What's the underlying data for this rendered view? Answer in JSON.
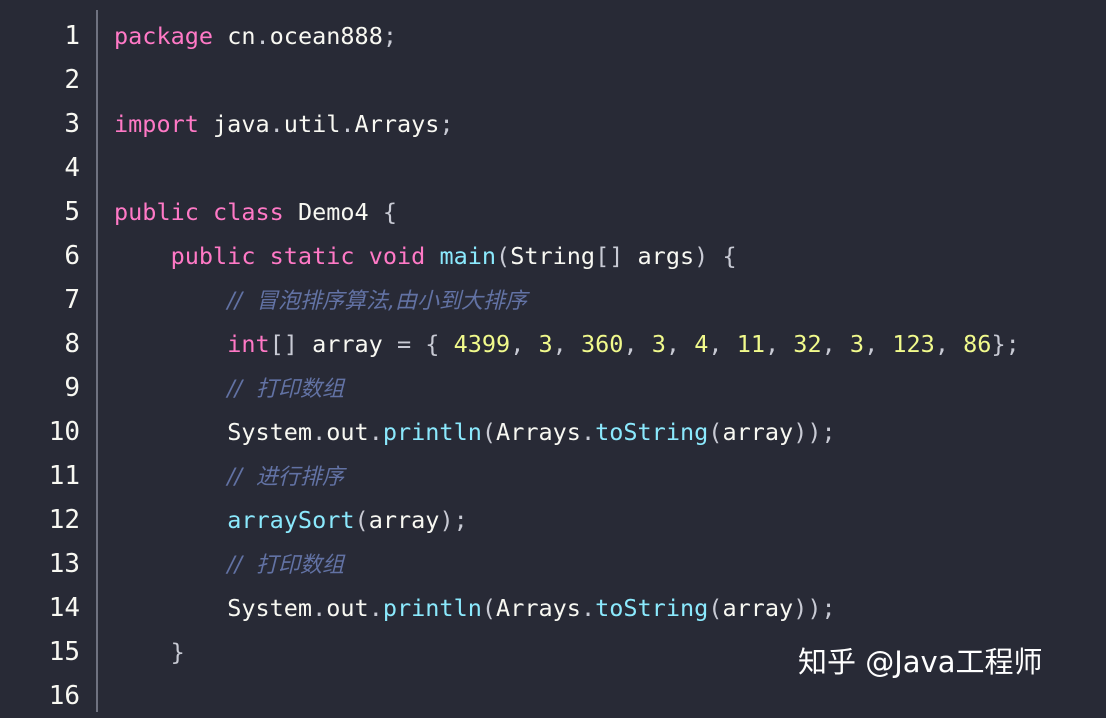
{
  "theme": {
    "background": "#282a36",
    "keyword_color": "#ff79c6",
    "function_color": "#8be9fd",
    "number_color": "#f1fa8c",
    "comment_color": "#6272a4",
    "text_color": "#f8f8f2"
  },
  "gutter": {
    "line_numbers": [
      "1",
      "2",
      "3",
      "4",
      "5",
      "6",
      "7",
      "8",
      "9",
      "10",
      "11",
      "12",
      "13",
      "14",
      "15",
      "16"
    ]
  },
  "code": {
    "lines": [
      [
        {
          "t": "package",
          "c": "kw"
        },
        {
          "t": " cn"
        },
        {
          "t": ".",
          "c": "pn"
        },
        {
          "t": "ocean888"
        },
        {
          "t": ";",
          "c": "pn"
        }
      ],
      [],
      [
        {
          "t": "import",
          "c": "kw"
        },
        {
          "t": " java"
        },
        {
          "t": ".",
          "c": "pn"
        },
        {
          "t": "util"
        },
        {
          "t": ".",
          "c": "pn"
        },
        {
          "t": "Arrays"
        },
        {
          "t": ";",
          "c": "pn"
        }
      ],
      [],
      [
        {
          "t": "public",
          "c": "kw"
        },
        {
          "t": " "
        },
        {
          "t": "class",
          "c": "kw"
        },
        {
          "t": " Demo4 "
        },
        {
          "t": "{",
          "c": "pn"
        }
      ],
      [
        {
          "t": "    "
        },
        {
          "t": "public",
          "c": "kw"
        },
        {
          "t": " "
        },
        {
          "t": "static",
          "c": "kw"
        },
        {
          "t": " "
        },
        {
          "t": "void",
          "c": "kw"
        },
        {
          "t": " "
        },
        {
          "t": "main",
          "c": "fn"
        },
        {
          "t": "(",
          "c": "pn"
        },
        {
          "t": "String"
        },
        {
          "t": "[]",
          "c": "pn"
        },
        {
          "t": " args"
        },
        {
          "t": ")",
          "c": "pn"
        },
        {
          "t": " "
        },
        {
          "t": "{",
          "c": "pn"
        }
      ],
      [
        {
          "t": "        "
        },
        {
          "t": "//  冒泡排序算法,由小到大排序",
          "c": "cm"
        }
      ],
      [
        {
          "t": "        "
        },
        {
          "t": "int",
          "c": "kw"
        },
        {
          "t": "[]",
          "c": "pn"
        },
        {
          "t": " array "
        },
        {
          "t": "=",
          "c": "pn"
        },
        {
          "t": " "
        },
        {
          "t": "{",
          "c": "pn"
        },
        {
          "t": " "
        },
        {
          "t": "4399",
          "c": "num"
        },
        {
          "t": ",",
          "c": "pn"
        },
        {
          "t": " "
        },
        {
          "t": "3",
          "c": "num"
        },
        {
          "t": ",",
          "c": "pn"
        },
        {
          "t": " "
        },
        {
          "t": "360",
          "c": "num"
        },
        {
          "t": ",",
          "c": "pn"
        },
        {
          "t": " "
        },
        {
          "t": "3",
          "c": "num"
        },
        {
          "t": ",",
          "c": "pn"
        },
        {
          "t": " "
        },
        {
          "t": "4",
          "c": "num"
        },
        {
          "t": ",",
          "c": "pn"
        },
        {
          "t": " "
        },
        {
          "t": "11",
          "c": "num"
        },
        {
          "t": ",",
          "c": "pn"
        },
        {
          "t": " "
        },
        {
          "t": "32",
          "c": "num"
        },
        {
          "t": ",",
          "c": "pn"
        },
        {
          "t": " "
        },
        {
          "t": "3",
          "c": "num"
        },
        {
          "t": ",",
          "c": "pn"
        },
        {
          "t": " "
        },
        {
          "t": "123",
          "c": "num"
        },
        {
          "t": ",",
          "c": "pn"
        },
        {
          "t": " "
        },
        {
          "t": "86",
          "c": "num"
        },
        {
          "t": "};",
          "c": "pn"
        }
      ],
      [
        {
          "t": "        "
        },
        {
          "t": "//  打印数组",
          "c": "cm"
        }
      ],
      [
        {
          "t": "        "
        },
        {
          "t": "System"
        },
        {
          "t": ".",
          "c": "pn"
        },
        {
          "t": "out"
        },
        {
          "t": ".",
          "c": "pn"
        },
        {
          "t": "println",
          "c": "fn"
        },
        {
          "t": "(",
          "c": "pn"
        },
        {
          "t": "Arrays"
        },
        {
          "t": ".",
          "c": "pn"
        },
        {
          "t": "toString",
          "c": "fn"
        },
        {
          "t": "(",
          "c": "pn"
        },
        {
          "t": "array"
        },
        {
          "t": "));",
          "c": "pn"
        }
      ],
      [
        {
          "t": "        "
        },
        {
          "t": "//  进行排序",
          "c": "cm"
        }
      ],
      [
        {
          "t": "        "
        },
        {
          "t": "arraySort",
          "c": "fn"
        },
        {
          "t": "(",
          "c": "pn"
        },
        {
          "t": "array"
        },
        {
          "t": ");",
          "c": "pn"
        }
      ],
      [
        {
          "t": "        "
        },
        {
          "t": "//  打印数组",
          "c": "cm"
        }
      ],
      [
        {
          "t": "        "
        },
        {
          "t": "System"
        },
        {
          "t": ".",
          "c": "pn"
        },
        {
          "t": "out"
        },
        {
          "t": ".",
          "c": "pn"
        },
        {
          "t": "println",
          "c": "fn"
        },
        {
          "t": "(",
          "c": "pn"
        },
        {
          "t": "Arrays"
        },
        {
          "t": ".",
          "c": "pn"
        },
        {
          "t": "toString",
          "c": "fn"
        },
        {
          "t": "(",
          "c": "pn"
        },
        {
          "t": "array"
        },
        {
          "t": "));",
          "c": "pn"
        }
      ],
      [
        {
          "t": "    "
        },
        {
          "t": "}",
          "c": "pn"
        }
      ],
      []
    ]
  },
  "watermark": {
    "text": "知乎 @Java工程师"
  }
}
